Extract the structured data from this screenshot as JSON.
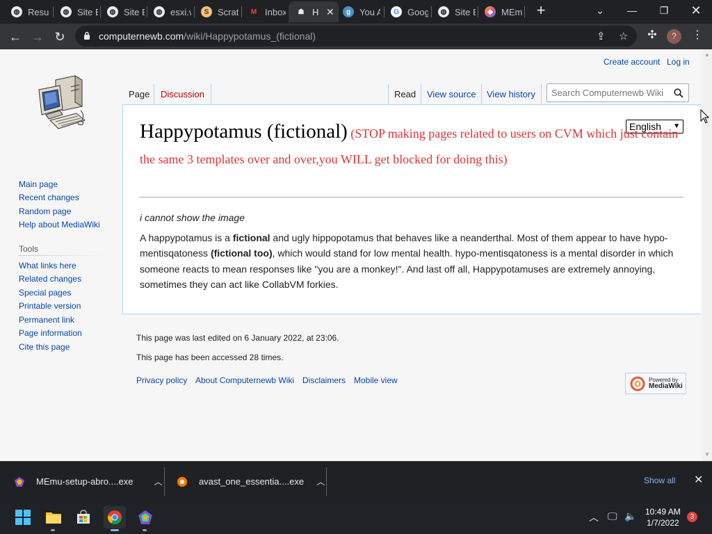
{
  "browser": {
    "tabs": [
      {
        "label": "Resu",
        "icon": "globe-icon"
      },
      {
        "label": "Site E",
        "icon": "globe-icon"
      },
      {
        "label": "Site E",
        "icon": "globe-icon"
      },
      {
        "label": "esxi.v",
        "icon": "globe-icon"
      },
      {
        "label": "Scrat",
        "icon": "scratch-icon"
      },
      {
        "label": "Inbox",
        "icon": "gmail-icon"
      },
      {
        "label": "H",
        "icon": "wiki-icon",
        "active": true
      },
      {
        "label": "You A",
        "icon": "g-icon"
      },
      {
        "label": "Goog",
        "icon": "google-icon"
      },
      {
        "label": "Site E",
        "icon": "globe-icon"
      },
      {
        "label": "MEmu",
        "icon": "memu-icon"
      }
    ],
    "url_host": "computernewb.com",
    "url_path": "/wiki/Happypotamus_(fictional)",
    "profile_initial": "?"
  },
  "wiki": {
    "personal": {
      "create_account": "Create account",
      "log_in": "Log in"
    },
    "nav": [
      "Main page",
      "Recent changes",
      "Random page",
      "Help about MediaWiki"
    ],
    "tools_heading": "Tools",
    "tools": [
      "What links here",
      "Related changes",
      "Special pages",
      "Printable version",
      "Permanent link",
      "Page information",
      "Cite this page"
    ],
    "tabs": {
      "page": "Page",
      "discussion": "Discussion",
      "read": "Read",
      "view_source": "View source",
      "view_history": "View history"
    },
    "search_placeholder": "Search Computernewb Wiki",
    "title": "Happypotamus (fictional)",
    "title_note": "(STOP making pages related to users on CVM which just contain the same 3 templates over and over,you WILL get blocked for doing this)",
    "language": "English",
    "image_caption": "i cannot show the image",
    "body": {
      "p1": "A happypotamus is a ",
      "b1": "fictional",
      "p2": " and ugly hippopotamus that behaves like a neanderthal. Most of them appear to have hypo-mentisqatoness ",
      "b2": "(fictional too)",
      "p3": ", which would stand for low mental health. hypo-mentisqatoness is a mental disorder in which someone reacts to mean responses like \"you are a monkey!\". And last off all, Happypotamuses are extremely annoying, sometimes they can act like CollabVM forkies."
    },
    "footer": {
      "last_edited": "This page was last edited on 6 January 2022, at 23:06.",
      "accessed": "This page has been accessed 28 times.",
      "links": [
        "Privacy policy",
        "About Computernewb Wiki",
        "Disclaimers",
        "Mobile view"
      ],
      "powered_line1": "Powered by",
      "powered_line2": "MediaWiki"
    }
  },
  "downloads": {
    "items": [
      "MEmu-setup-abro....exe",
      "avast_one_essentia....exe"
    ],
    "show_all": "Show all"
  },
  "taskbar": {
    "time": "10:49 AM",
    "date": "1/7/2022",
    "notifications": "3"
  }
}
